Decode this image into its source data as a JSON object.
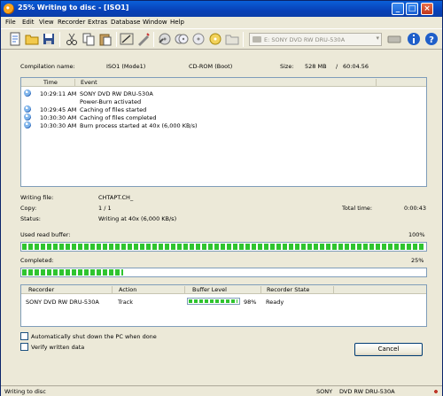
{
  "window": {
    "title": "25% Writing to disc - [ISO1]"
  },
  "menu": [
    "File",
    "Edit",
    "View",
    "Recorder",
    "Extras",
    "Database",
    "Window",
    "Help"
  ],
  "toolbar": {
    "drive": "E: SONY    DVD RW DRU-530A",
    "icons": [
      "new-icon",
      "open-icon",
      "save-icon",
      "cut-icon",
      "copy-icon",
      "paste-icon",
      "burn-icon",
      "compile-icon",
      "record-icon",
      "eject-icon",
      "disc-icon",
      "folder-icon",
      "drive-icon",
      "info-icon",
      "help-icon"
    ]
  },
  "compilation": {
    "name_label": "Compilation name:",
    "name": "ISO1 (Mode1)",
    "type": "CD-ROM (Boot)",
    "size_label": "Size:",
    "size": "528 MB",
    "duration": "60:04.56"
  },
  "events": {
    "col_time": "Time",
    "col_event": "Event",
    "rows": [
      {
        "time": "10:29:11 AM",
        "event": "SONY DVD RW DRU-530A",
        "icon": true
      },
      {
        "time": "",
        "event": "Power-Burn activated",
        "icon": false
      },
      {
        "time": "10:29:45 AM",
        "event": "Caching of files started",
        "icon": true
      },
      {
        "time": "10:30:30 AM",
        "event": "Caching of files completed",
        "icon": true
      },
      {
        "time": "10:30:30 AM",
        "event": "Burn process started at 40x (6,000 KB/s)",
        "icon": true
      }
    ]
  },
  "status": {
    "writing_label": "Writing file:",
    "writing_file": "CHTAPT.CH_",
    "copy_label": "Copy:",
    "copy": "1 / 1",
    "total_time_label": "Total time:",
    "total_time": "0:00:43",
    "status_label": "Status:",
    "status": "Writing at 40x (6,000 KB/s)"
  },
  "buffer": {
    "label": "Used read buffer:",
    "percent_text": "100%",
    "fraction": 1.0
  },
  "completed": {
    "label": "Completed:",
    "percent_text": "25%",
    "fraction": 0.25
  },
  "recorders": {
    "cols": [
      "Recorder",
      "Action",
      "Buffer Level",
      "Recorder State"
    ],
    "rows": [
      {
        "recorder": "SONY DVD RW DRU-530A",
        "action": "Track",
        "buffer_text": "98%",
        "buffer_fraction": 0.98,
        "state": "Ready"
      }
    ]
  },
  "options": {
    "shutdown": "Automatically shut down the PC when done",
    "verify": "Verify written data"
  },
  "cancel_label": "Cancel",
  "statusbar": {
    "left": "Writing to disc",
    "vendor": "SONY",
    "drive": "DVD RW DRU-530A"
  }
}
